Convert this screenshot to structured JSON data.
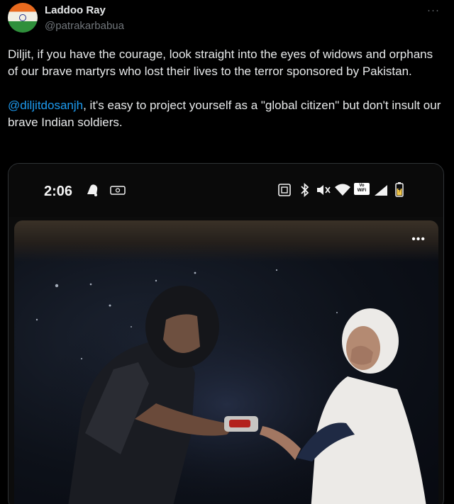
{
  "tweet": {
    "author_name": "Laddoo Ray",
    "author_handle": "@patrakarbabua",
    "more_label": "···",
    "paragraph1": "Diljit, if you have the courage, look straight into the eyes of widows and orphans of our brave martyrs who lost their lives to the terror sponsored by Pakistan.",
    "mention": "@diljitdosanjh",
    "paragraph2_rest": ", it's easy to project yourself as a \"global citizen\" but don't insult our brave Indian soldiers."
  },
  "media": {
    "status_time": "2:06",
    "vowifi_line1": "Vo",
    "vowifi_line2": "WiFi",
    "video_more_label": "•••",
    "icons": [
      "notification-bell-icon",
      "dollar-bill-icon",
      "screenshot-icon",
      "bluetooth-icon",
      "mute-icon",
      "wifi-icon",
      "vowifi-badge",
      "cellular-signal-icon",
      "battery-icon"
    ]
  },
  "colors": {
    "background": "#000000",
    "text": "#e7e9ea",
    "secondary": "#71767b",
    "link": "#1d9bf0",
    "border": "#2f3336"
  }
}
